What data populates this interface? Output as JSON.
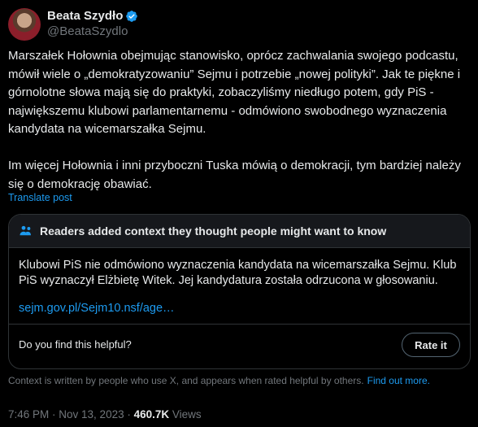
{
  "author": {
    "display_name": "Beata Szydło",
    "handle": "@BeataSzydlo",
    "verified": true,
    "avatar_icon": "profile-photo"
  },
  "tweet": {
    "text": "Marszałek Hołownia obejmując stanowisko, oprócz zachwalania swojego podcastu, mówił wiele o „demokratyzowaniu” Sejmu i potrzebie „nowej polityki”. Jak te piękne i górnolotne słowa mają się do praktyki, zobaczyliśmy niedługo potem, gdy PiS - największemu klubowi parlamentarnemu - odmówiono swobodnego wyznaczenia kandydata na wicemarszałka Sejmu.\n\nIm więcej Hołownia i inni przyboczni Tuska mówią o demokracji, tym bardziej należy się o demokrację obawiać.",
    "translate_label": "Translate post"
  },
  "community_note": {
    "header": "Readers added context they thought people might want to know",
    "header_icon": "people-icon",
    "body": "Klubowi PiS nie odmówiono wyznaczenia kandydata na wicemarszałka Sejmu. Klub PiS wyznaczył Elżbietę Witek. Jej kandydatura została odrzucona w głosowaniu.",
    "link": "sejm.gov.pl/Sejm10.nsf/age…",
    "helpful_question": "Do you find this helpful?",
    "rate_button": "Rate it"
  },
  "context_footer": {
    "text": "Context is written by people who use X, and appears when rated helpful by others.",
    "link": "Find out more."
  },
  "meta": {
    "time": "7:46 PM",
    "separator": " · ",
    "date": "Nov 13, 2023",
    "views_count": "460.7K",
    "views_label": "Views"
  },
  "colors": {
    "background": "#000000",
    "text": "#e7e9ea",
    "muted": "#71767b",
    "link": "#1d9bf0",
    "border": "#2f3336"
  }
}
